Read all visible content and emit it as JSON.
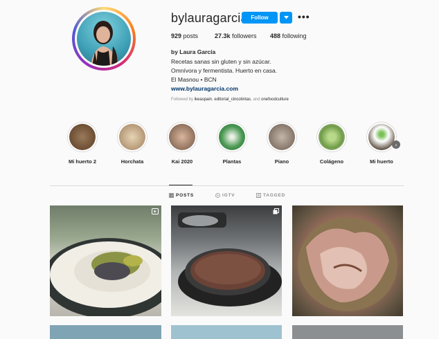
{
  "profile": {
    "username": "bylauragarcia",
    "follow_label": "Follow",
    "more_label": "•••",
    "stats": {
      "posts": "929",
      "posts_label": "posts",
      "followers": "27.3k",
      "followers_label": "followers",
      "following": "488",
      "following_label": "following"
    },
    "full_name": "by Laura García",
    "bio_lines": [
      "Recetas sanas sin gluten y sin azúcar.",
      "Omnívora y fermentista. Huerto en casa.",
      "El Masnou • BCN"
    ],
    "website": "www.bylauragarcia.com",
    "followed_by_prefix": "Followed by",
    "followed_by": [
      "ikeaspain",
      "editorial_cincotintas",
      "onefoodculture"
    ],
    "followed_by_and": "and"
  },
  "highlights": [
    {
      "label": "Mi huerto 2",
      "color": "#7a5a3a"
    },
    {
      "label": "Horchata",
      "color": "#c9b08a"
    },
    {
      "label": "Kai 2020",
      "color": "#8c7060"
    },
    {
      "label": "Plantas",
      "color": "#3e8a4a"
    },
    {
      "label": "Piano",
      "color": "#9a8a80"
    },
    {
      "label": "Colágeno",
      "color": "#7fae5a"
    },
    {
      "label": "Mi huerto",
      "color": "#4a6a3a"
    }
  ],
  "tabs": [
    {
      "label": "POSTS",
      "active": true
    },
    {
      "label": "IGTV",
      "active": false
    },
    {
      "label": "TAGGED",
      "active": false
    }
  ],
  "colors": {
    "accent": "#0095f6",
    "text": "#262626",
    "muted": "#8e8e8e",
    "link": "#00376b"
  }
}
